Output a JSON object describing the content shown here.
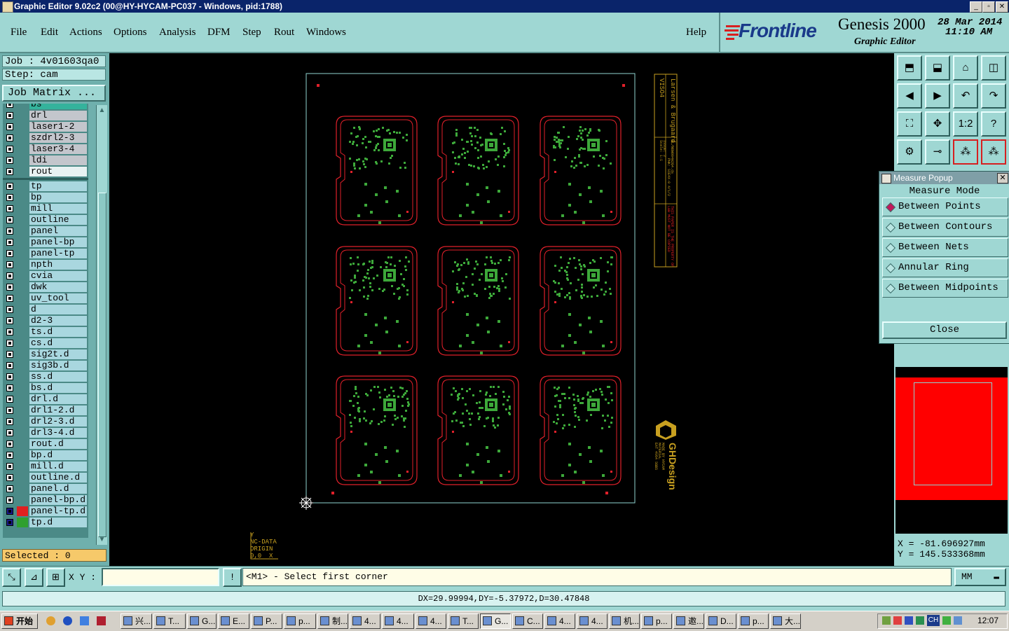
{
  "window": {
    "title": "Graphic Editor 9.02c2 (00@HY-HYCAM-PC037 - Windows, pid:1788)",
    "controls": [
      "_",
      "▫",
      "✕"
    ]
  },
  "menu": [
    "File",
    "Edit",
    "Actions",
    "Options",
    "Analysis",
    "DFM",
    "Step",
    "Rout",
    "Windows"
  ],
  "help": "Help",
  "brand": {
    "logo": "Frontline",
    "product": "Genesis 2000",
    "subtitle": "Graphic Editor",
    "date": "28 Mar 2014",
    "time": "11:10 AM"
  },
  "left": {
    "job": "Job : 4v01603qa0",
    "step": "Step: cam",
    "job_matrix": "Job Matrix ...",
    "selected": "Selected : 0",
    "layers_group1": [
      {
        "name": "bs",
        "style": "sel"
      },
      {
        "name": "drl",
        "style": "gray"
      },
      {
        "name": "laser1-2",
        "style": "gray"
      },
      {
        "name": "szdrl2-3",
        "style": "gray"
      },
      {
        "name": "laser3-4",
        "style": "gray"
      },
      {
        "name": "ldi",
        "style": "gray"
      },
      {
        "name": "rout",
        "style": "hl"
      }
    ],
    "layers_group2": [
      {
        "name": "tp",
        "flag": "◢"
      },
      {
        "name": "bp"
      },
      {
        "name": "mill"
      },
      {
        "name": "outline"
      },
      {
        "name": "panel"
      },
      {
        "name": "panel-bp"
      },
      {
        "name": "panel-tp"
      },
      {
        "name": "npth"
      },
      {
        "name": "cvia"
      },
      {
        "name": "dwk"
      },
      {
        "name": "uv_tool"
      },
      {
        "name": "d"
      },
      {
        "name": "d2-3"
      },
      {
        "name": "ts.d"
      },
      {
        "name": "cs.d",
        "flag": "◢"
      },
      {
        "name": "sig2t.d"
      },
      {
        "name": "sig3b.d"
      },
      {
        "name": "ss.d"
      },
      {
        "name": "bs.d"
      },
      {
        "name": "drl.d"
      },
      {
        "name": "drl1-2.d"
      },
      {
        "name": "drl2-3.d"
      },
      {
        "name": "drl3-4.d"
      },
      {
        "name": "rout.d"
      },
      {
        "name": "bp.d"
      },
      {
        "name": "mill.d"
      },
      {
        "name": "outline.d"
      },
      {
        "name": "panel.d"
      },
      {
        "name": "panel-bp.d"
      },
      {
        "name": "panel-tp.d",
        "flag": "⊞",
        "swatch": "#e02020"
      },
      {
        "name": "tp.d",
        "flag": "◢",
        "swatch": "#2fa02f"
      }
    ]
  },
  "canvas": {
    "title_block": [
      "VISO4",
      "Larsen & Brugaard",
      "NL/N8W004H2G4.ds",
      "PHK: SIE4X-0 4/1/2",
      "Issue: 2",
      "Scale: 1:1",
      "THIS PAPER IS THE PROPERTY OF",
      "L&B MUST NOT BE COPIED"
    ],
    "ghd_logo": "GHDesign",
    "ghd_caption": [
      "MADE BY HYCAM",
      "MATERIAL",
      "EAT 4V64 SGBS"
    ],
    "origin_label": [
      "Y",
      "NC-DATA",
      "ORIGIN",
      "0,0",
      "X"
    ],
    "colors": {
      "outline": "#e0202a",
      "pad": "#3da83a",
      "frame": "#8fd3d0",
      "block": "#c8a020"
    }
  },
  "measure_popup": {
    "title": "Measure Popup",
    "mode_label": "Measure Mode",
    "options": [
      "Between Points",
      "Between Contours",
      "Between Nets",
      "Annular Ring",
      "Between Midpoints"
    ],
    "selected_index": 0,
    "close": "Close"
  },
  "coords": {
    "x": "X = -81.696927mm",
    "y": "Y = 145.533368mm"
  },
  "command": {
    "xy_label": "X Y :",
    "xy_value": "",
    "prompt": "<M1> - Select first corner",
    "unit": "MM"
  },
  "status": "DX=29.99994,DY=-5.37972,D=30.47848",
  "taskbar": {
    "start": "开始",
    "items": [
      "兴...",
      "T...",
      "G...",
      "E...",
      "P...",
      "p...",
      "制...",
      "4...",
      "4...",
      "4...",
      "T...",
      "G...",
      "C...",
      "4...",
      "4...",
      "机...",
      "p...",
      "邀...",
      "D...",
      "p...",
      "大..."
    ],
    "active_index": 11,
    "clock": "12:07",
    "tray_lang": "CH"
  }
}
